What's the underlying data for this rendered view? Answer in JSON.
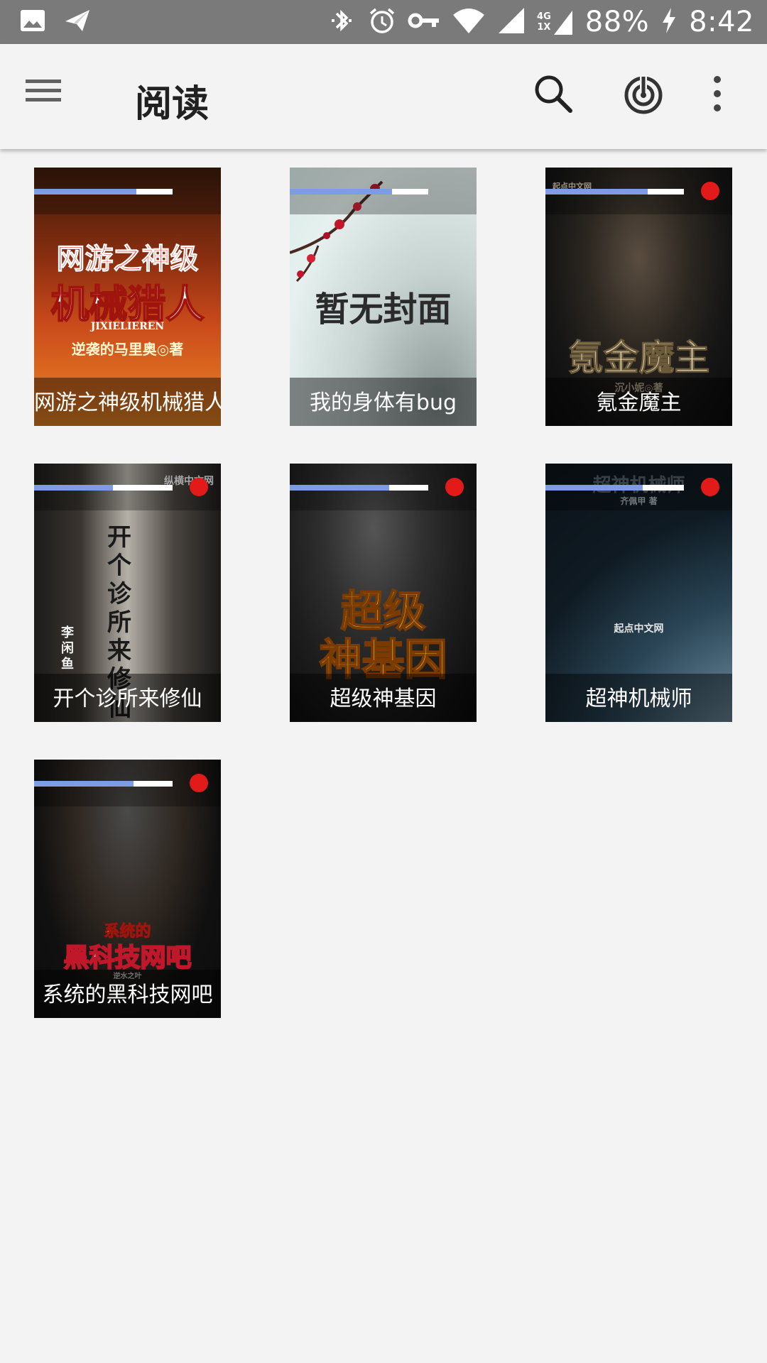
{
  "status_bar": {
    "icons": [
      "image-icon",
      "send-icon",
      "bluetooth-icon",
      "alarm-icon",
      "vpn-key-icon",
      "wifi-icon",
      "signal-icon"
    ],
    "network_label_top": "4G",
    "network_label_bottom": "1X",
    "battery": "88%",
    "time": "8:42"
  },
  "app_bar": {
    "title": "阅读",
    "menu_icon": "hamburger-menu-icon",
    "actions": [
      "search-icon",
      "radar-icon",
      "more-vert-icon"
    ]
  },
  "books": [
    {
      "title": "网游之神级机械猎人",
      "progress": 0.74,
      "unread": false,
      "cover_text": [
        "网游之神级",
        "机械猎人",
        "JIXIELIEREN",
        "逆袭的马里奥◎著"
      ],
      "colors": {
        "bg_top": "#3a1c0c",
        "bg_mid": "#c8491a",
        "bg_bottom": "#f08a25"
      }
    },
    {
      "title": "我的身体有bug",
      "progress": 0.74,
      "unread": false,
      "cover_text": [
        "暂无封面"
      ],
      "colors": {
        "bg_top": "#cfe6e2",
        "bg_mid": "#e8f3f1",
        "bg_bottom": "#bcc6c4"
      }
    },
    {
      "title": "氪金魔主",
      "progress": 0.74,
      "unread": true,
      "cover_text": [
        "起点中文网",
        "氪金魔主",
        "沉小妮◎著"
      ],
      "colors": {
        "bg_top": "#2b2620",
        "bg_mid": "#151515",
        "bg_bottom": "#0c0c0c"
      }
    },
    {
      "title": "开个诊所来修仙",
      "progress": 0.57,
      "unread": true,
      "cover_text": [
        "纵横中文网",
        "开个诊所来修仙",
        "李闲鱼"
      ],
      "colors": {
        "bg_top": "#3a3530",
        "bg_mid": "#8e8a85",
        "bg_bottom": "#1c1b1a"
      }
    },
    {
      "title": "超级神基因",
      "progress": 0.72,
      "unread": true,
      "cover_text": [
        "超级",
        "神基因"
      ],
      "colors": {
        "bg_top": "#2f2f2f",
        "bg_mid": "#1e1e1e",
        "bg_bottom": "#0a0a0a"
      }
    },
    {
      "title": "超神机械师",
      "progress": 0.7,
      "unread": true,
      "cover_text": [
        "超神机械师",
        "齐佩甲 著",
        "起点中文网"
      ],
      "colors": {
        "bg_top": "#0f1a22",
        "bg_mid": "#2a4556",
        "bg_bottom": "#0b1218"
      }
    },
    {
      "title": "系统的黑科技网吧",
      "progress": 0.72,
      "unread": true,
      "cover_text": [
        "系统的",
        "黑科技网吧",
        "逆水之叶"
      ],
      "colors": {
        "bg_top": "#101010",
        "bg_mid": "#2e2620",
        "bg_bottom": "#0d0d0d"
      }
    }
  ]
}
